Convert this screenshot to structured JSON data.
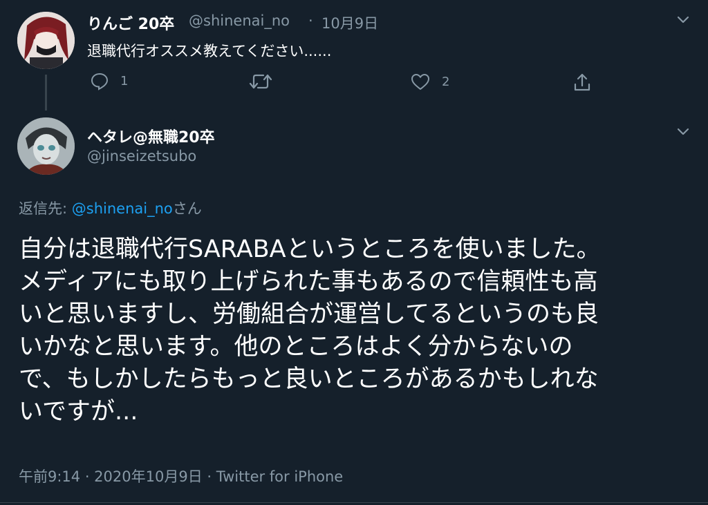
{
  "parent_tweet": {
    "display_name": "りんご 20卒",
    "handle": "@shinenai_no",
    "separator": "·",
    "date": "10月9日",
    "text": "退職代行オススメ教えてください......",
    "actions": {
      "reply_count": "1",
      "retweet_count": "",
      "like_count": "2"
    }
  },
  "reply_tweet": {
    "display_name": "ヘタレ@無職20卒",
    "handle": "@jinseizetsubo",
    "reply_to_label": "返信先: ",
    "reply_to_mention": "@shinenai_no",
    "reply_to_suffix": "さん",
    "body_lines": [
      "自分は退職代行SARABAというところを使いました。",
      "メディアにも取り上げられた事もあるので信頼性も高",
      "いと思いますし、労働組合が運営してるというのも良",
      "いかなと思います。他のところはよく分からないの",
      "で、もしかしたらもっと良いところがあるかもしれな",
      "いですが..."
    ],
    "meta": "午前9:14 · 2020年10月9日 · Twitter for iPhone"
  },
  "colors": {
    "background": "#15202b",
    "primary_text": "#ffffff",
    "secondary_text": "#8899a6",
    "link": "#1da1f2",
    "divider": "#38444d"
  },
  "icons": {
    "reply": "speech-bubble-icon",
    "retweet": "retweet-icon",
    "like": "heart-icon",
    "share": "share-icon",
    "more": "chevron-down-icon"
  }
}
